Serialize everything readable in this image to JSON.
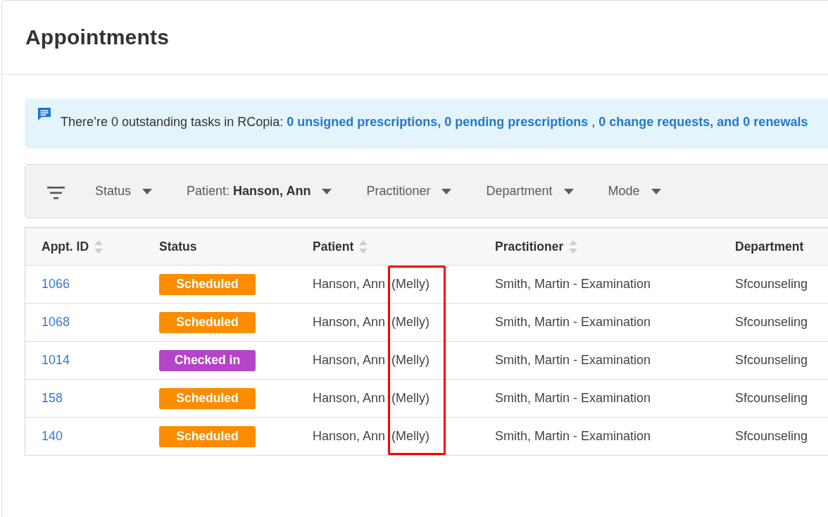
{
  "page": {
    "title": "Appointments"
  },
  "notice": {
    "text": "There’re 0 outstanding tasks in RCopia:",
    "links": [
      "0 unsigned prescriptions, 0 pending prescriptions",
      "0 change requests, and 0 renewals"
    ],
    "separator": ","
  },
  "filters": [
    {
      "label": "Status"
    },
    {
      "label": "Patient:",
      "value": "Hanson, Ann"
    },
    {
      "label": "Practitioner"
    },
    {
      "label": "Department"
    },
    {
      "label": "Mode"
    }
  ],
  "table": {
    "columns": [
      {
        "label": "Appt. ID",
        "sortable": true
      },
      {
        "label": "Status",
        "sortable": false
      },
      {
        "label": "Patient",
        "sortable": true
      },
      {
        "label": "Practitioner",
        "sortable": true
      },
      {
        "label": "Department",
        "sortable": false
      }
    ],
    "rows": [
      {
        "id": "1066",
        "status": {
          "label": "Scheduled",
          "color": "#fb8c00"
        },
        "patient": "Hanson, Ann",
        "nickname": "(Melly)",
        "practitioner": "Smith, Martin - Examination",
        "department": "Sfcounseling"
      },
      {
        "id": "1068",
        "status": {
          "label": "Scheduled",
          "color": "#fb8c00"
        },
        "patient": "Hanson, Ann",
        "nickname": "(Melly)",
        "practitioner": "Smith, Martin - Examination",
        "department": "Sfcounseling"
      },
      {
        "id": "1014",
        "status": {
          "label": "Checked in",
          "color": "#b444c8"
        },
        "patient": "Hanson, Ann",
        "nickname": "(Melly)",
        "practitioner": "Smith, Martin - Examination",
        "department": "Sfcounseling"
      },
      {
        "id": "158",
        "status": {
          "label": "Scheduled",
          "color": "#fb8c00"
        },
        "patient": "Hanson, Ann",
        "nickname": "(Melly)",
        "practitioner": "Smith, Martin - Examination",
        "department": "Sfcounseling"
      },
      {
        "id": "140",
        "status": {
          "label": "Scheduled",
          "color": "#fb8c00"
        },
        "patient": "Hanson, Ann",
        "nickname": "(Melly)",
        "practitioner": "Smith, Martin - Examination",
        "department": "Sfcounseling"
      }
    ],
    "nickname_highlighted": true
  }
}
